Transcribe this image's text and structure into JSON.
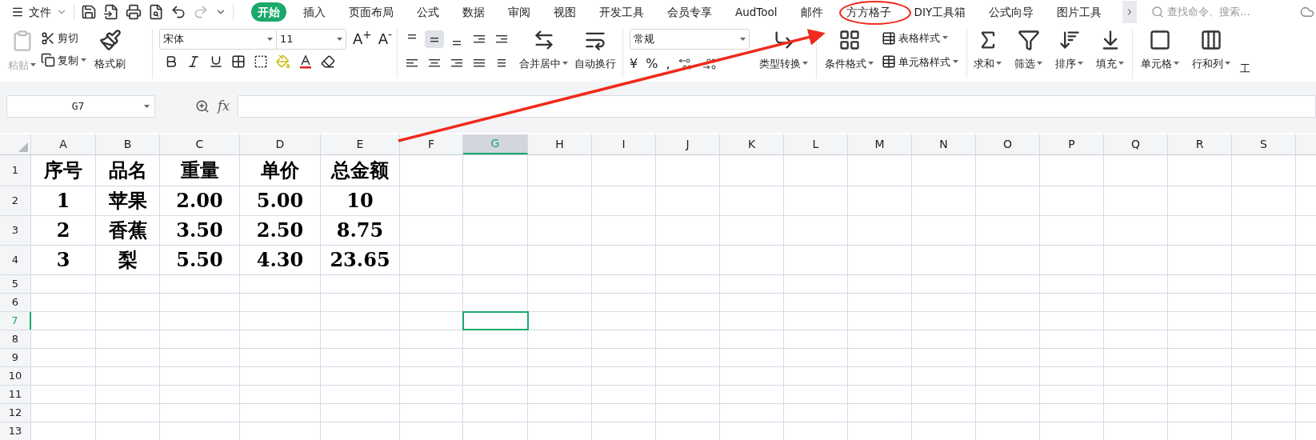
{
  "menu_bar": {
    "file_menu": "文件",
    "tabs": [
      {
        "label": "开始",
        "selected": true
      },
      {
        "label": "插入",
        "selected": false
      },
      {
        "label": "页面布局",
        "selected": false
      },
      {
        "label": "公式",
        "selected": false
      },
      {
        "label": "数据",
        "selected": false
      },
      {
        "label": "审阅",
        "selected": false
      },
      {
        "label": "视图",
        "selected": false
      },
      {
        "label": "开发工具",
        "selected": false
      },
      {
        "label": "会员专享",
        "selected": false
      },
      {
        "label": "AudTool",
        "selected": false
      },
      {
        "label": "邮件",
        "selected": false
      },
      {
        "label": "方方格子",
        "selected": false
      },
      {
        "label": "DIY工具箱",
        "selected": false
      },
      {
        "label": "公式向导",
        "selected": false
      },
      {
        "label": "图片工具",
        "selected": false
      }
    ],
    "search": {
      "placeholder": "查找命令、搜索..."
    }
  },
  "ribbon": {
    "paste": {
      "label": "粘贴",
      "disabled": true
    },
    "cut": "剪切",
    "copy": "复制",
    "format_painter": "格式刷",
    "font_name": "宋体",
    "font_size": "11",
    "grow_font": "A$^{+}$",
    "shrink_font": "A$^{-}$",
    "currency": "¥",
    "percent": "%",
    "thousands": ",",
    "vertical_align": [
      {
        "selected": false
      },
      {
        "selected": true
      },
      {
        "selected": false
      }
    ],
    "merge_center": "合并居中",
    "wrap_text": "自动换行",
    "number_format": "常规",
    "type_convert": "类型转换",
    "conditional_format": "条件格式",
    "table_style": "表格样式",
    "cell_style": "单元格样式",
    "sum": "求和",
    "filter": "筛选",
    "sort": "排序",
    "fill": "填充",
    "cells": "单元格",
    "rows_columns": "行和列",
    "cut_off_label": "工"
  },
  "formula_bar": {
    "name_box": "G7",
    "function_label": "fx"
  },
  "sheet": {
    "columns": [
      {
        "label": "A",
        "selected": false
      },
      {
        "label": "B",
        "selected": false
      },
      {
        "label": "C",
        "selected": false
      },
      {
        "label": "D",
        "selected": false
      },
      {
        "label": "E",
        "selected": false
      },
      {
        "label": "F",
        "selected": false
      },
      {
        "label": "G",
        "selected": true
      },
      {
        "label": "H",
        "selected": false
      },
      {
        "label": "I",
        "selected": false
      },
      {
        "label": "J",
        "selected": false
      },
      {
        "label": "K",
        "selected": false
      },
      {
        "label": "L",
        "selected": false
      },
      {
        "label": "M",
        "selected": false
      },
      {
        "label": "N",
        "selected": false
      },
      {
        "label": "O",
        "selected": false
      },
      {
        "label": "P",
        "selected": false
      },
      {
        "label": "Q",
        "selected": false
      },
      {
        "label": "R",
        "selected": false
      },
      {
        "label": "S",
        "selected": false
      }
    ],
    "rows": [
      {
        "label": "1",
        "selected": false,
        "cells": [
          "序号",
          "品名",
          "重量",
          "单价",
          "总金额"
        ]
      },
      {
        "label": "2",
        "selected": false,
        "cells": [
          "1",
          "苹果",
          "2.00",
          "5.00",
          "10"
        ]
      },
      {
        "label": "3",
        "selected": false,
        "cells": [
          "2",
          "香蕉",
          "3.50",
          "2.50",
          "8.75"
        ]
      },
      {
        "label": "4",
        "selected": false,
        "cells": [
          "3",
          "梨",
          "5.50",
          "4.30",
          "23.65"
        ]
      },
      {
        "label": "5",
        "selected": false
      },
      {
        "label": "6",
        "selected": false
      },
      {
        "label": "7",
        "selected": true
      },
      {
        "label": "8",
        "selected": false
      },
      {
        "label": "9",
        "selected": false
      },
      {
        "label": "10",
        "selected": false
      },
      {
        "label": "11",
        "selected": false
      },
      {
        "label": "12",
        "selected": false
      },
      {
        "label": "13",
        "selected": false
      }
    ]
  }
}
